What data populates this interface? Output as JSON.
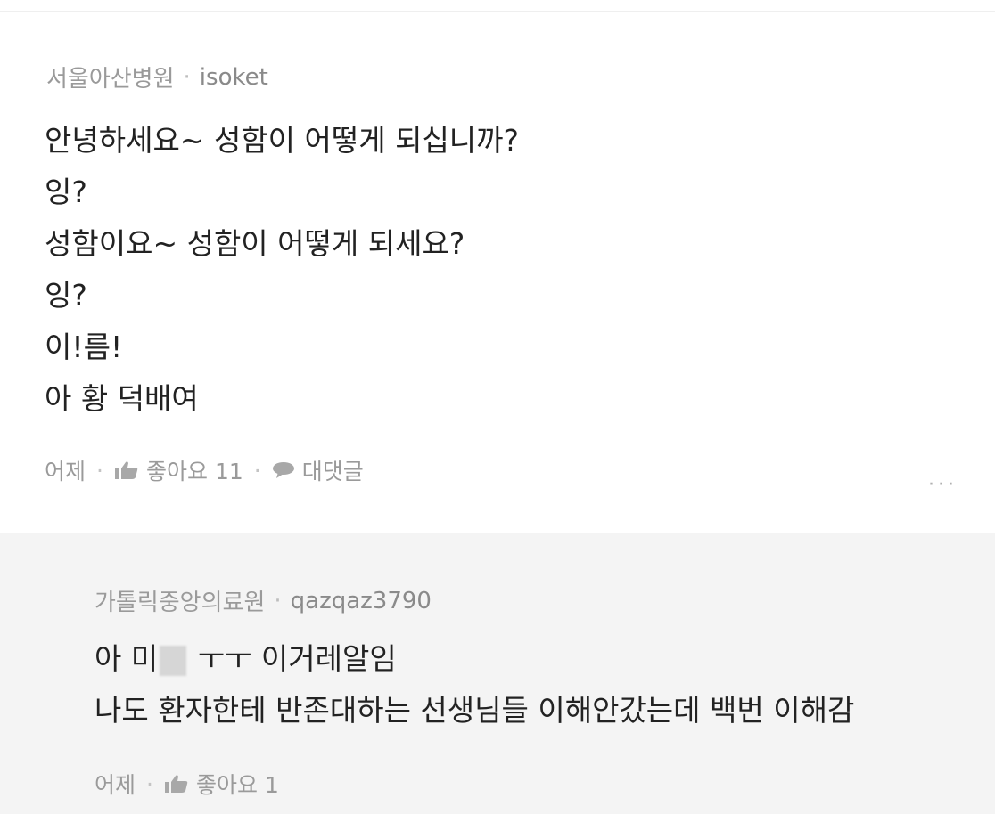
{
  "comment": {
    "hospital": "서울아산병원",
    "user": "isoket",
    "lines": [
      "안녕하세요~ 성함이 어떻게 되십니까?",
      "잉?",
      "성함이요~ 성함이 어떻게 되세요?",
      "잉?",
      "이!름!",
      "아 황 덕배여"
    ],
    "time": "어제",
    "like_label": "좋아요",
    "like_count": "11",
    "reply_label": "대댓글",
    "more_label": "···"
  },
  "reply": {
    "hospital": "가톨릭중앙의료원",
    "user": "qazqaz3790",
    "line1_before": "아 미",
    "line1_after": " ㅜㅜ 이거레알임",
    "line2": "나도 환자한테 반존대하는 선생님들 이해안갔는데 백번 이해감",
    "time": "어제",
    "like_label": "좋아요",
    "like_count": "1"
  },
  "icons": {
    "like": "thumbs-up-icon",
    "reply": "speech-bubble-icon",
    "more": "more-dots-icon"
  },
  "colors": {
    "text": "#222222",
    "meta": "#9a9a9a",
    "reply_bg": "#f4f4f4"
  }
}
